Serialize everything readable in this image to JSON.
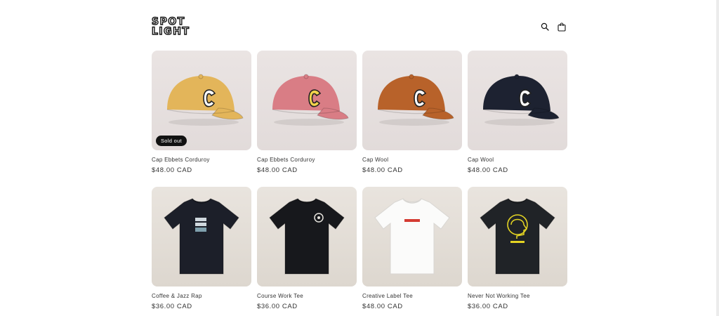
{
  "brand": {
    "logo_line1": "SPOT",
    "logo_line2": "LIGHT"
  },
  "header": {
    "icons": [
      "search-icon",
      "cart-icon"
    ]
  },
  "products": [
    {
      "title": "Cap Ebbets Corduroy",
      "price": "$48.00 CAD",
      "badge": "Sold out",
      "kind": "cap",
      "color": "#e3b55a",
      "logo_color": "#ffffff"
    },
    {
      "title": "Cap Ebbets Corduroy",
      "price": "$48.00 CAD",
      "badge": "",
      "kind": "cap",
      "color": "#d97d85",
      "logo_color": "#f2d34b"
    },
    {
      "title": "Cap Wool",
      "price": "$48.00 CAD",
      "badge": "",
      "kind": "cap",
      "color": "#b8622a",
      "logo_color": "#ffffff"
    },
    {
      "title": "Cap Wool",
      "price": "$48.00 CAD",
      "badge": "",
      "kind": "cap",
      "color": "#1d2231",
      "logo_color": "#ffffff"
    },
    {
      "title": "Coffee & Jazz Rap",
      "price": "$36.00 CAD",
      "badge": "",
      "kind": "tee",
      "color": "#1c1f29",
      "graphic": "stack"
    },
    {
      "title": "Course Work Tee",
      "price": "$36.00 CAD",
      "badge": "",
      "kind": "tee",
      "color": "#17181c",
      "graphic": "small-logo"
    },
    {
      "title": "Creative Label Tee",
      "price": "$48.00 CAD",
      "badge": "",
      "kind": "tee",
      "color": "#fbfbfa",
      "graphic": "label"
    },
    {
      "title": "Never Not Working Tee",
      "price": "$36.00 CAD",
      "badge": "",
      "kind": "tee",
      "color": "#202327",
      "graphic": "head"
    }
  ]
}
